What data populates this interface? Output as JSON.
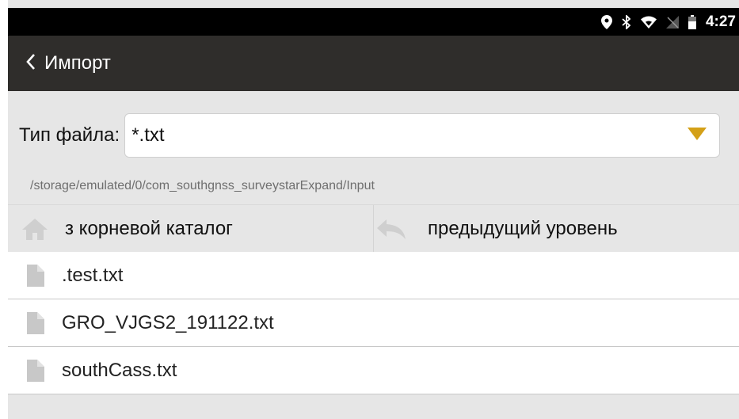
{
  "status_bar": {
    "time": "4:27",
    "icons": [
      "location-icon",
      "bluetooth-icon",
      "wifi-icon",
      "no-signal-icon",
      "battery-icon"
    ]
  },
  "app_bar": {
    "back_icon": "chevron-left-icon",
    "title": "Импорт"
  },
  "file_type": {
    "label": "Тип файла:",
    "value": "*.txt",
    "dropdown_icon": "triangle-down-icon",
    "accent_color": "#d4a017"
  },
  "path": "/storage/emulated/0/com_southgnss_surveystarExpand/Input",
  "nav": {
    "root_label": "з корневой каталог",
    "root_icon": "home-icon",
    "up_label": "предыдущий уровень",
    "up_icon": "back-arrow-icon"
  },
  "files": [
    {
      "name": ".test.txt",
      "icon": "file-icon"
    },
    {
      "name": "GRO_VJGS2_191122.txt",
      "icon": "file-icon"
    },
    {
      "name": "southCass.txt",
      "icon": "file-icon"
    }
  ]
}
